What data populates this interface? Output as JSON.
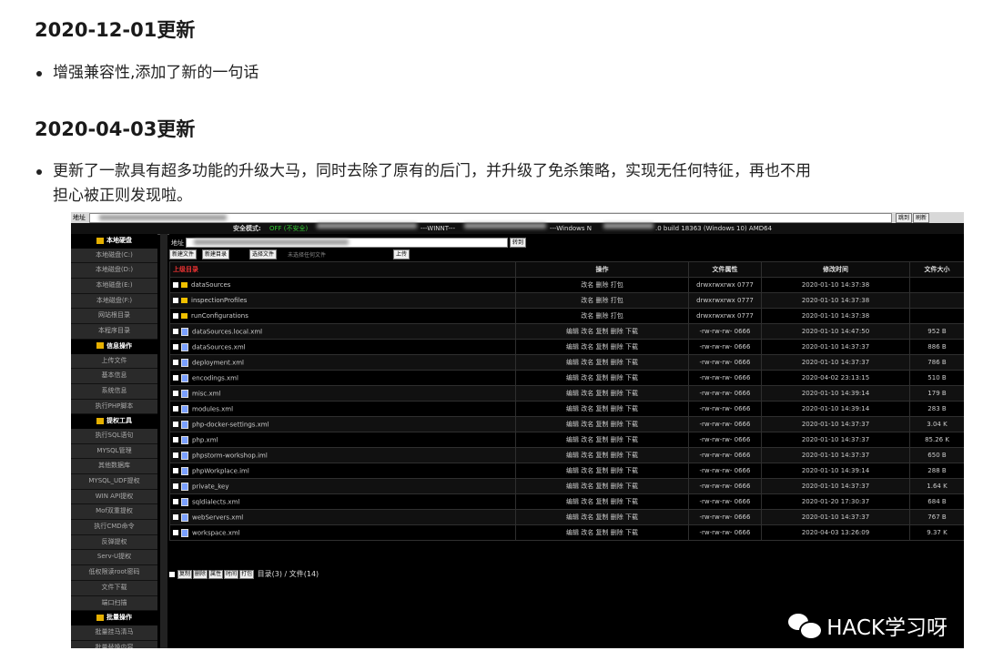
{
  "sections": [
    {
      "heading": "2020-12-01更新",
      "bullets": [
        "增强兼容性,添加了新的一句话"
      ]
    },
    {
      "heading": "2020-04-03更新",
      "bullets": [
        "更新了一款具有超多功能的升级大马，同时去除了原有的后门，并升级了免杀策略，实现无任何特征，再也不用",
        "担心被正则发现啦。"
      ]
    }
  ],
  "screenshot": {
    "address_label": "地址",
    "jump_btn": "跳到",
    "refresh_btn": "刷新",
    "info": {
      "safe_mode": "安全模式:",
      "safe_off": "OFF (不安全)",
      "os1": "---WINNT---",
      "os2": "---Windows N",
      "build": ".0 build 18363 (Windows 10) AMD64"
    },
    "sidebar": [
      {
        "type": "head",
        "label": "本地硬盘"
      },
      {
        "type": "item",
        "label": "本地磁盘(C:)"
      },
      {
        "type": "item",
        "label": "本地磁盘(D:)"
      },
      {
        "type": "item",
        "label": "本地磁盘(E:)"
      },
      {
        "type": "item",
        "label": "本地磁盘(F:)"
      },
      {
        "type": "item",
        "label": "网站根目录"
      },
      {
        "type": "item",
        "label": "本程序目录"
      },
      {
        "type": "head",
        "label": "信息操作"
      },
      {
        "type": "item",
        "label": "上传文件"
      },
      {
        "type": "item",
        "label": "基本信息"
      },
      {
        "type": "item",
        "label": "系统信息"
      },
      {
        "type": "item",
        "label": "执行PHP脚本"
      },
      {
        "type": "head",
        "label": "提权工具"
      },
      {
        "type": "item",
        "label": "执行SQL语句"
      },
      {
        "type": "item",
        "label": "MYSQL管理"
      },
      {
        "type": "item",
        "label": "其他数据库"
      },
      {
        "type": "item",
        "label": "MYSQL_UDF提权"
      },
      {
        "type": "item",
        "label": "WIN API提权"
      },
      {
        "type": "item",
        "label": "Mof双重提权"
      },
      {
        "type": "item",
        "label": "执行CMD命令"
      },
      {
        "type": "item",
        "label": "反弹提权"
      },
      {
        "type": "item",
        "label": "Serv-U提权"
      },
      {
        "type": "item",
        "label": "低权限读root密码"
      },
      {
        "type": "item",
        "label": "文件下载"
      },
      {
        "type": "item",
        "label": "端口扫描"
      },
      {
        "type": "head",
        "label": "批量操作"
      },
      {
        "type": "item",
        "label": "批量挂马清马"
      },
      {
        "type": "item",
        "label": "批量替换内容"
      }
    ],
    "main": {
      "addr_label": "地址",
      "goto_btn": "转到",
      "new_file": "新建文件",
      "new_dir": "新建目录",
      "choose_file": "选择文件",
      "no_file": "未选择任何文件",
      "upload": "上传",
      "columns": [
        "上级目录",
        "操作",
        "文件属性",
        "修改时间",
        "文件大小"
      ],
      "rows": [
        {
          "kind": "dir",
          "name": "dataSources",
          "ops": "改名 删除 打包",
          "perm": "drwxrwxrwx 0777",
          "time": "2020-01-10 14:37:38",
          "size": ""
        },
        {
          "kind": "dir",
          "name": "inspectionProfiles",
          "ops": "改名 删除 打包",
          "perm": "drwxrwxrwx 0777",
          "time": "2020-01-10 14:37:38",
          "size": ""
        },
        {
          "kind": "dir",
          "name": "runConfigurations",
          "ops": "改名 删除 打包",
          "perm": "drwxrwxrwx 0777",
          "time": "2020-01-10 14:37:38",
          "size": ""
        },
        {
          "kind": "file",
          "name": "dataSources.local.xml",
          "ops": "编辑 改名 复制 删除 下载",
          "perm": "-rw-rw-rw- 0666",
          "time": "2020-01-10 14:47:50",
          "size": "952 B"
        },
        {
          "kind": "file",
          "name": "dataSources.xml",
          "ops": "编辑 改名 复制 删除 下载",
          "perm": "-rw-rw-rw- 0666",
          "time": "2020-01-10 14:37:37",
          "size": "886 B"
        },
        {
          "kind": "file",
          "name": "deployment.xml",
          "ops": "编辑 改名 复制 删除 下载",
          "perm": "-rw-rw-rw- 0666",
          "time": "2020-01-10 14:37:37",
          "size": "786 B"
        },
        {
          "kind": "file",
          "name": "encodings.xml",
          "ops": "编辑 改名 复制 删除 下载",
          "perm": "-rw-rw-rw- 0666",
          "time": "2020-04-02 23:13:15",
          "size": "510 B"
        },
        {
          "kind": "file",
          "name": "misc.xml",
          "ops": "编辑 改名 复制 删除 下载",
          "perm": "-rw-rw-rw- 0666",
          "time": "2020-01-10 14:39:14",
          "size": "179 B"
        },
        {
          "kind": "file",
          "name": "modules.xml",
          "ops": "编辑 改名 复制 删除 下载",
          "perm": "-rw-rw-rw- 0666",
          "time": "2020-01-10 14:39:14",
          "size": "283 B"
        },
        {
          "kind": "file",
          "name": "php-docker-settings.xml",
          "ops": "编辑 改名 复制 删除 下载",
          "perm": "-rw-rw-rw- 0666",
          "time": "2020-01-10 14:37:37",
          "size": "3.04 K"
        },
        {
          "kind": "file",
          "name": "php.xml",
          "ops": "编辑 改名 复制 删除 下载",
          "perm": "-rw-rw-rw- 0666",
          "time": "2020-01-10 14:37:37",
          "size": "85.26 K"
        },
        {
          "kind": "file",
          "name": "phpstorm-workshop.iml",
          "ops": "编辑 改名 复制 删除 下载",
          "perm": "-rw-rw-rw- 0666",
          "time": "2020-01-10 14:37:37",
          "size": "650 B"
        },
        {
          "kind": "file",
          "name": "phpWorkplace.iml",
          "ops": "编辑 改名 复制 删除 下载",
          "perm": "-rw-rw-rw- 0666",
          "time": "2020-01-10 14:39:14",
          "size": "288 B"
        },
        {
          "kind": "file",
          "name": "private_key",
          "ops": "编辑 改名 复制 删除 下载",
          "perm": "-rw-rw-rw- 0666",
          "time": "2020-01-10 14:37:37",
          "size": "1.64 K"
        },
        {
          "kind": "file",
          "name": "sqldialects.xml",
          "ops": "编辑 改名 复制 删除 下载",
          "perm": "-rw-rw-rw- 0666",
          "time": "2020-01-20 17:30:37",
          "size": "684 B"
        },
        {
          "kind": "file",
          "name": "webServers.xml",
          "ops": "编辑 改名 复制 删除 下载",
          "perm": "-rw-rw-rw- 0666",
          "time": "2020-01-10 14:37:37",
          "size": "767 B"
        },
        {
          "kind": "file",
          "name": "workspace.xml",
          "ops": "编辑 改名 复制 删除 下载",
          "perm": "-rw-rw-rw- 0666",
          "time": "2020-04-03 13:26:09",
          "size": "9.37 K"
        }
      ],
      "footer_btns": [
        "复制",
        "删除",
        "属性",
        "时间",
        "打包"
      ],
      "footer_text": "目录(3) / 文件(14)"
    },
    "watermark": "HACK学习呀"
  }
}
